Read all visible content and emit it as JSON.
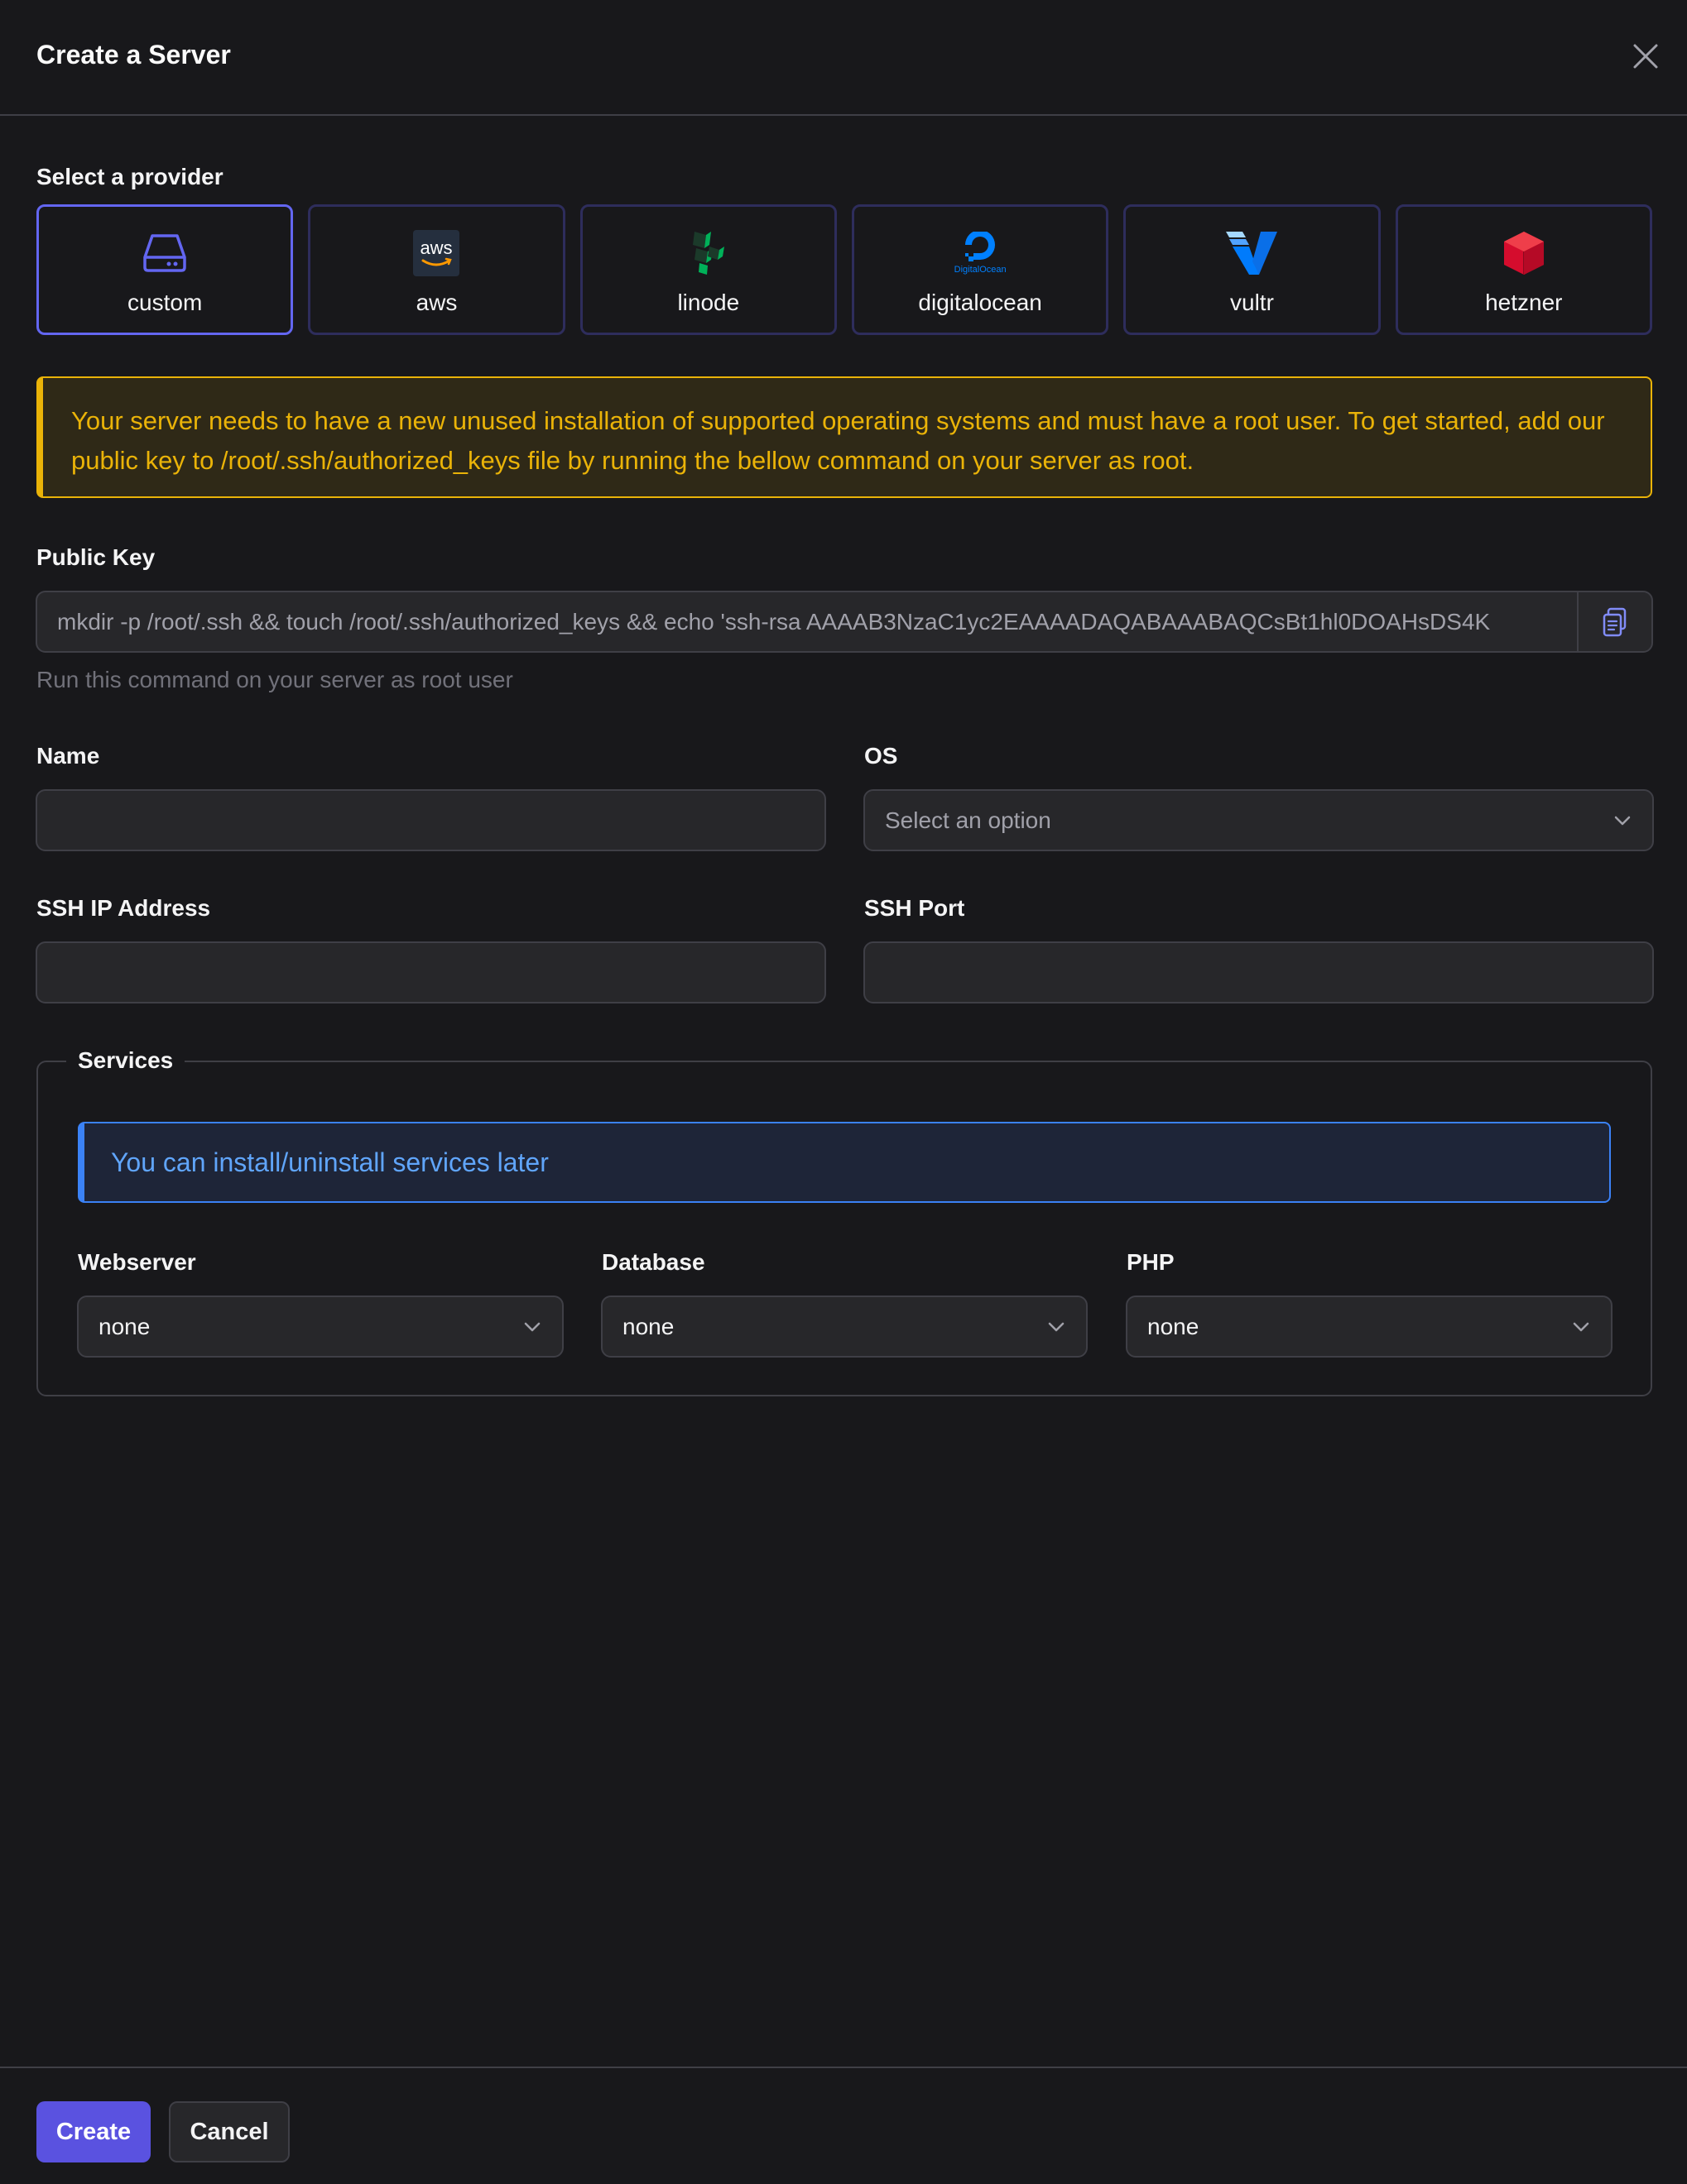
{
  "modal": {
    "title": "Create a Server"
  },
  "provider_section": {
    "label": "Select a provider",
    "selected": "custom",
    "providers": [
      {
        "name": "custom",
        "icon": "hard-drive-icon"
      },
      {
        "name": "aws",
        "icon": "aws-logo"
      },
      {
        "name": "linode",
        "icon": "linode-logo"
      },
      {
        "name": "digitalocean",
        "icon": "digitalocean-logo",
        "logo_text": "DigitalOcean"
      },
      {
        "name": "vultr",
        "icon": "vultr-logo"
      },
      {
        "name": "hetzner",
        "icon": "hetzner-logo"
      }
    ]
  },
  "aws_logo_text": "aws",
  "warning": {
    "text": "Your server needs to have a new unused installation of supported operating systems and must have a root user. To get started, add our public key to /root/.ssh/authorized_keys file by running the bellow command on your server as root."
  },
  "public_key": {
    "label": "Public Key",
    "value": "mkdir -p /root/.ssh && touch /root/.ssh/authorized_keys && echo 'ssh-rsa AAAAB3NzaC1yc2EAAAADAQABAAABAQCsBt1hl0DOAHsDS4K",
    "hint": "Run this command on your server as root user"
  },
  "form": {
    "name_label": "Name",
    "name_value": "",
    "os_label": "OS",
    "os_placeholder": "Select an option",
    "ssh_ip_label": "SSH IP Address",
    "ssh_ip_value": "",
    "ssh_port_label": "SSH Port",
    "ssh_port_value": ""
  },
  "services": {
    "legend": "Services",
    "info": "You can install/uninstall services later",
    "webserver_label": "Webserver",
    "webserver_value": "none",
    "database_label": "Database",
    "database_value": "none",
    "php_label": "PHP",
    "php_value": "none"
  },
  "footer": {
    "create_label": "Create",
    "cancel_label": "Cancel"
  },
  "colors": {
    "accent": "#6366f1",
    "warning": "#eab308",
    "info": "#3b82f6",
    "background": "#18181b"
  }
}
